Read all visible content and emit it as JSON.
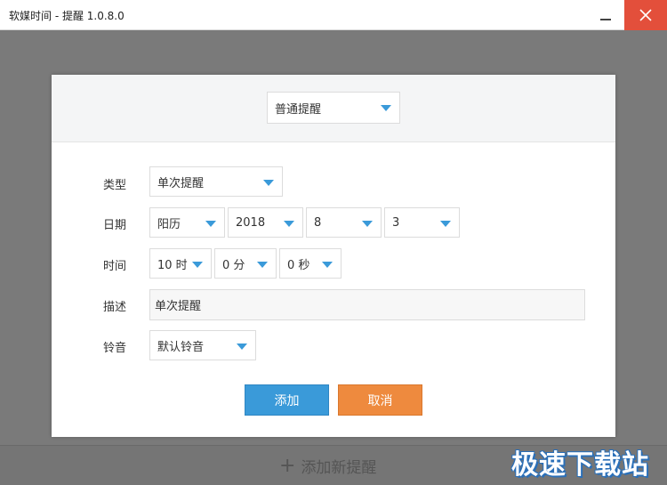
{
  "window": {
    "title": "软媒时间 - 提醒 1.0.8.0"
  },
  "dialog": {
    "mode": {
      "selected": "普通提醒"
    },
    "type": {
      "label": "类型",
      "selected": "单次提醒"
    },
    "date": {
      "label": "日期",
      "calendar": "阳历",
      "year": "2018",
      "month": "8",
      "day": "3"
    },
    "time": {
      "label": "时间",
      "hour": "10 时",
      "minute": "0 分",
      "second": "0 秒"
    },
    "description": {
      "label": "描述",
      "value": "单次提醒"
    },
    "ringtone": {
      "label": "铃音",
      "selected": "默认铃音"
    },
    "buttons": {
      "add": "添加",
      "cancel": "取消"
    }
  },
  "footer": {
    "add_new_label": "添加新提醒",
    "add_icon": "plus-icon"
  },
  "watermark": "极速下载站",
  "colors": {
    "accent_blue": "#3a9ad9",
    "cancel_orange": "#ee8a3e",
    "close_red": "#e34f3b"
  }
}
